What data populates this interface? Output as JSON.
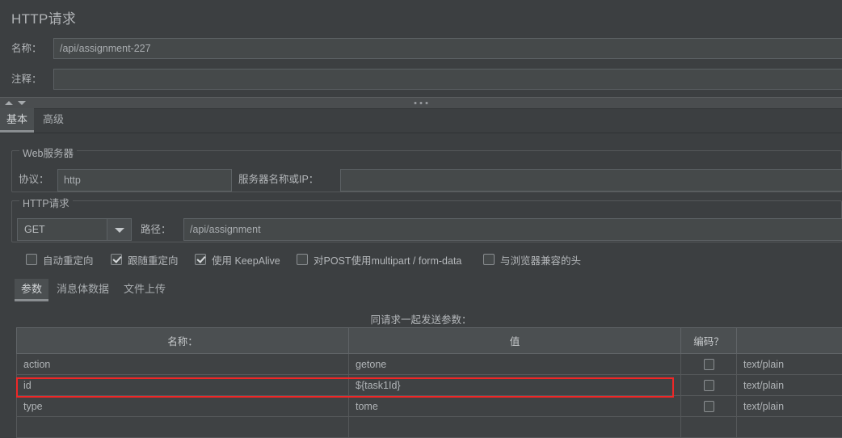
{
  "panel": {
    "title": "HTTP请求"
  },
  "header_fields": [
    {
      "label": "名称：",
      "value": "/api/assignment-227"
    },
    {
      "label": "注释：",
      "value": ""
    }
  ],
  "main_tabs": [
    {
      "label": "基本",
      "selected": true
    },
    {
      "label": "高级",
      "selected": false
    }
  ],
  "web_server": {
    "group_title": "Web服务器",
    "protocol_label": "协议：",
    "protocol_value": "http",
    "server_label": "服务器名称或IP：",
    "server_value": ""
  },
  "http_request": {
    "group_title": "HTTP请求",
    "method": "GET",
    "path_label": "路径：",
    "path_value": "/api/assignment"
  },
  "options": [
    {
      "label": "自动重定向",
      "checked": false
    },
    {
      "label": "跟随重定向",
      "checked": true
    },
    {
      "label": "使用 KeepAlive",
      "checked": true
    },
    {
      "label": "对POST使用multipart / form-data",
      "checked": false
    },
    {
      "label": "与浏览器兼容的头",
      "checked": false
    }
  ],
  "sub_tabs": [
    {
      "label": "参数",
      "selected": true
    },
    {
      "label": "消息体数据",
      "selected": false
    },
    {
      "label": "文件上传",
      "selected": false
    }
  ],
  "params_table": {
    "caption": "同请求一起发送参数：",
    "columns": [
      "名称：",
      "值",
      "编码？",
      ""
    ],
    "rows": [
      {
        "name": "action",
        "value": "getone",
        "encode": false,
        "content_type": "text/plain",
        "highlighted": false
      },
      {
        "name": "id",
        "value": "${task1Id}",
        "encode": false,
        "content_type": "text/plain",
        "highlighted": true
      },
      {
        "name": "type",
        "value": "tome",
        "encode": false,
        "content_type": "text/plain",
        "highlighted": false
      }
    ]
  },
  "colors": {
    "background": "#3c3f41",
    "input_background": "#45494a",
    "border": "#55585a",
    "text": "#b4b7ba",
    "highlight_red": "#ef2727",
    "tab_selected_bg": "#4b4f51"
  },
  "icons": {
    "splitter_dots": "dots-icon",
    "scroll_up": "triangle-up-icon",
    "scroll_down": "triangle-down-icon",
    "combo_arrow": "chevron-down-icon"
  }
}
